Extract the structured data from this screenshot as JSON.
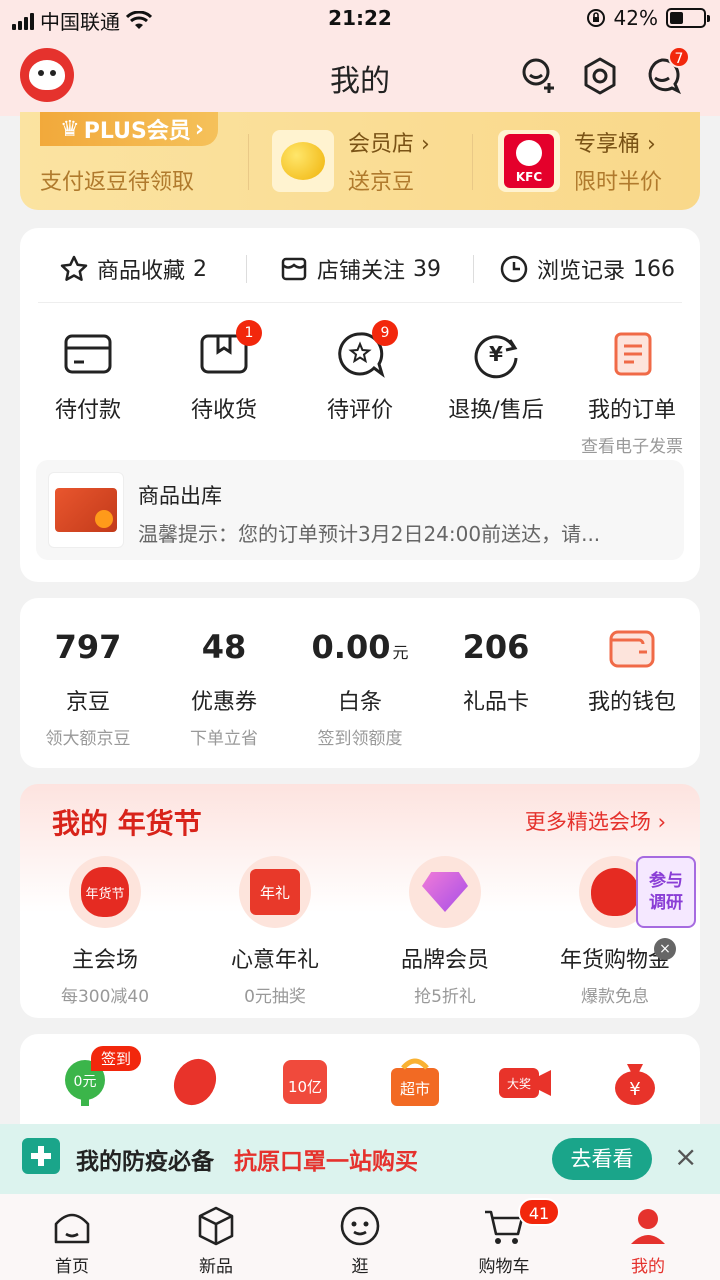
{
  "status_bar": {
    "carrier": "中国联通",
    "time": "21:22",
    "battery": "42%",
    "battery_level": 0.42
  },
  "header": {
    "title": "我的",
    "messages_badge": "7"
  },
  "plus": {
    "tag": "PLUS会员",
    "subtitle": "支付返豆待领取",
    "items": [
      {
        "title": "会员店",
        "subtitle": "送京豆"
      },
      {
        "title": "专享桶",
        "subtitle": "限时半价",
        "logo_text": "KFC"
      }
    ]
  },
  "favorites": [
    {
      "label": "商品收藏",
      "count": "2"
    },
    {
      "label": "店铺关注",
      "count": "39"
    },
    {
      "label": "浏览记录",
      "count": "166"
    }
  ],
  "orders": [
    {
      "label": "待付款",
      "badge": ""
    },
    {
      "label": "待收货",
      "badge": "1"
    },
    {
      "label": "待评价",
      "badge": "9"
    },
    {
      "label": "退换/售后",
      "badge": ""
    },
    {
      "label": "我的订单",
      "sub": "查看电子发票"
    }
  ],
  "shipment": {
    "title": "商品出库",
    "desc": "温馨提示：您的订单预计3月2日24:00前送达，请..."
  },
  "wallet": [
    {
      "value": "797",
      "unit": "",
      "label": "京豆",
      "sub": "领大额京豆"
    },
    {
      "value": "48",
      "unit": "",
      "label": "优惠券",
      "sub": "下单立省"
    },
    {
      "value": "0.00",
      "unit": "元",
      "label": "白条",
      "sub": "签到领额度"
    },
    {
      "value": "206",
      "unit": "",
      "label": "礼品卡",
      "sub": ""
    },
    {
      "value": "",
      "unit": "",
      "label": "我的钱包",
      "sub": ""
    }
  ],
  "festival": {
    "title": "我的 年货节",
    "more": "更多精选会场 ›",
    "items": [
      {
        "label": "主会场",
        "sub": "每300减40",
        "icon_text": "年货节"
      },
      {
        "label": "心意年礼",
        "sub": "0元抽奖",
        "icon_text": "年礼"
      },
      {
        "label": "品牌会员",
        "sub": "抢5折礼"
      },
      {
        "label": "年货购物金",
        "sub": "爆款免息"
      }
    ],
    "survey": "参与调研"
  },
  "tools": {
    "sign_label": "签到",
    "zero": "0元",
    "items": [
      "10亿",
      "超市",
      "大奖",
      "¥"
    ]
  },
  "promo": {
    "title": "我的防疫必备",
    "highlight": "抗原口罩一站购买",
    "button": "去看看",
    "close": "×"
  },
  "tabbar": [
    {
      "label": "首页",
      "active": false
    },
    {
      "label": "新品",
      "active": false
    },
    {
      "label": "逛",
      "active": false
    },
    {
      "label": "购物车",
      "active": false,
      "badge": "41"
    },
    {
      "label": "我的",
      "active": true
    }
  ],
  "colors": {
    "brand_red": "#e5322d",
    "badge_red": "#f2270c",
    "plus_gold": "#f2a93b",
    "promo_green": "#1aa58a"
  }
}
